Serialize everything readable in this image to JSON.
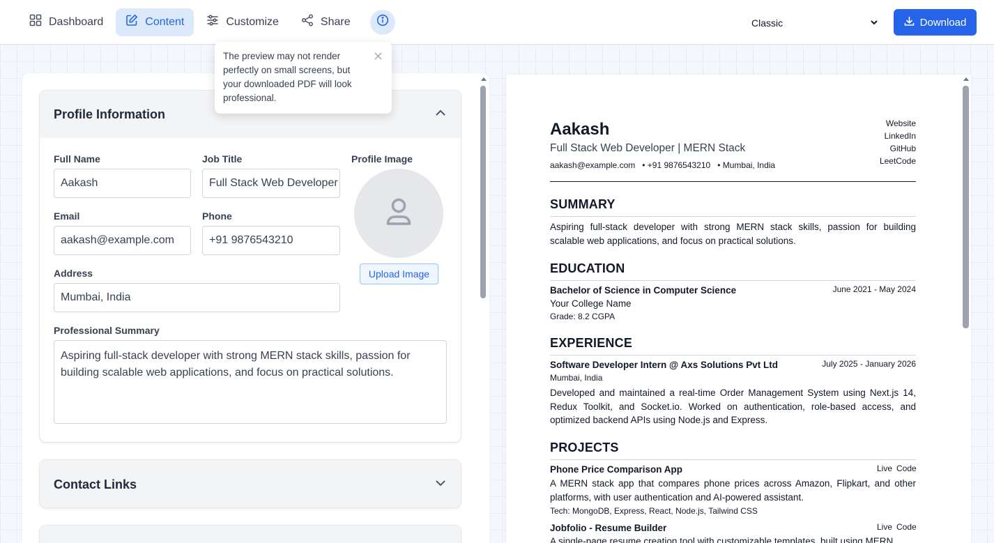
{
  "nav": {
    "dashboard": "Dashboard",
    "content": "Content",
    "customize": "Customize",
    "share": "Share"
  },
  "template_select": {
    "value": "Classic"
  },
  "download_label": "Download",
  "tooltip": {
    "text": "The preview may not render perfectly on small screens, but your downloaded PDF will look professional."
  },
  "profile": {
    "title": "Profile Information",
    "full_name_label": "Full Name",
    "full_name": "Aakash",
    "job_title_label": "Job Title",
    "job_title": "Full Stack Web Developer",
    "profile_image_label": "Profile Image",
    "upload_label": "Upload Image",
    "email_label": "Email",
    "email": "aakash@example.com",
    "phone_label": "Phone",
    "phone": "+91 9876543210",
    "address_label": "Address",
    "address": "Mumbai, India",
    "summary_label": "Professional Summary",
    "summary": "Aspiring full-stack developer with strong MERN stack skills, passion for building scalable web applications, and focus on practical solutions."
  },
  "contact_links": {
    "title": "Contact Links"
  },
  "resume": {
    "name": "Aakash",
    "headline": "Full Stack Web Developer | MERN Stack",
    "contact_line": "aakash@example.com   • +91 9876543210   • Mumbai, India",
    "links": [
      "Website",
      "LinkedIn",
      "GitHub",
      "LeetCode"
    ],
    "summary_heading": "SUMMARY",
    "summary": "Aspiring full-stack developer with strong MERN stack skills, passion for building scalable web applications, and focus on practical solutions.",
    "education_heading": "EDUCATION",
    "education": {
      "degree": "Bachelor of Science in Computer Science",
      "dates": "June 2021 - May 2024",
      "school": "Your College Name",
      "grade": "Grade: 8.2 CGPA"
    },
    "experience_heading": "EXPERIENCE",
    "experience": {
      "role": "Software Developer Intern @ Axs Solutions Pvt Ltd",
      "dates": "July 2025 - January 2026",
      "location": "Mumbai, India",
      "description": "Developed and maintained a real-time Order Management System using Next.js 14, Redux Toolkit, and Socket.io. Worked on authentication, role-based access, and optimized backend APIs using Node.js and Express."
    },
    "projects_heading": "PROJECTS",
    "projects": [
      {
        "title": "Phone Price Comparison App",
        "live": "Live",
        "code": "Code",
        "description": "A MERN stack app that compares phone prices across Amazon, Flipkart, and other platforms, with user authentication and AI-powered assistant.",
        "tech": "Tech: MongoDB, Express, React, Node.js, Tailwind CSS"
      },
      {
        "title": "Jobfolio - Resume Builder",
        "live": "Live",
        "code": "Code",
        "description": "A single-page resume creation tool with customizable templates, built using MERN"
      }
    ]
  }
}
